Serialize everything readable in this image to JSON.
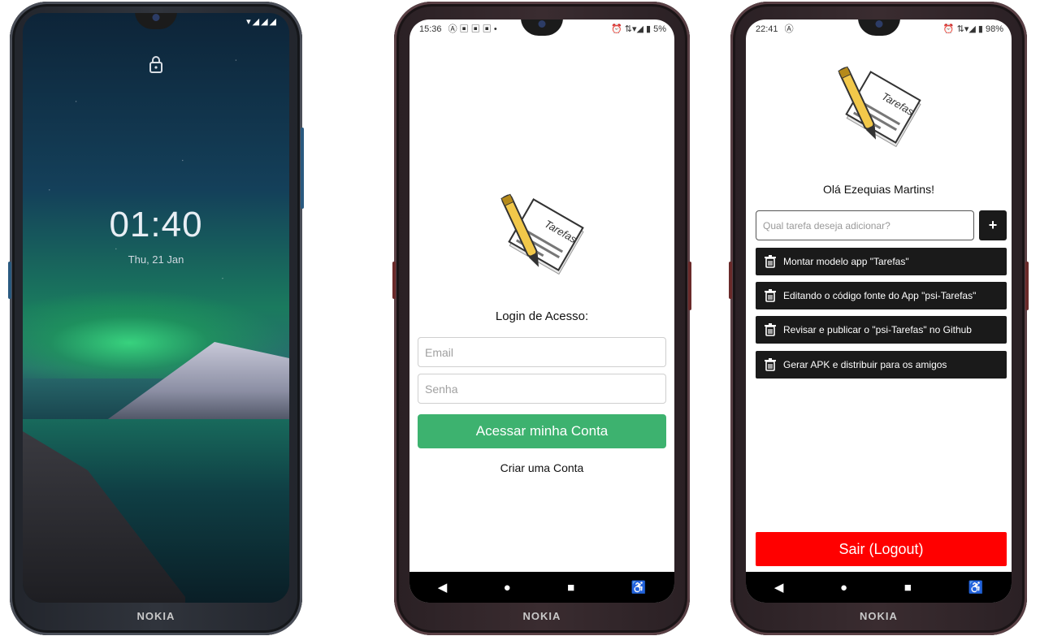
{
  "phone1": {
    "brand": "NOKIA",
    "lock_time": "01:40",
    "lock_date": "Thu, 21 Jan",
    "lock_icon": "lock-icon",
    "status_icons": "▾◢◢◢"
  },
  "phone2": {
    "brand": "NOKIA",
    "status_time": "15:36",
    "status_left_icons": "Ⓐ ▣ ▣ ▣ •",
    "status_right": "⏰ ⇅▾◢ ▮ 5%",
    "logo_text": "Tarefas",
    "login_title": "Login de Acesso:",
    "email_placeholder": "Email",
    "password_placeholder": "Senha",
    "login_button": "Acessar minha Conta",
    "create_account": "Criar uma Conta",
    "colors": {
      "primary": "#3db26f"
    }
  },
  "phone3": {
    "brand": "NOKIA",
    "status_time": "22:41",
    "status_left_icons": "Ⓐ",
    "status_right": "⏰ ⇅▾◢ ▮ 98%",
    "logo_text": "Tarefas",
    "greeting": "Olá Ezequias Martins!",
    "task_placeholder": "Qual tarefa deseja adicionar?",
    "add_button": "+",
    "tasks": [
      "Montar modelo app \"Tarefas\"",
      "Editando o código fonte do App \"psi-Tarefas\"",
      "Revisar e publicar o \"psi-Tarefas\" no Github",
      "Gerar APK e distribuir para os amigos"
    ],
    "logout_button": "Sair (Logout)",
    "colors": {
      "logout": "#ff0000",
      "task_bg": "#1a1a1a"
    }
  },
  "nav": {
    "back": "◀",
    "home": "●",
    "recents": "■",
    "accessibility": "♿"
  }
}
